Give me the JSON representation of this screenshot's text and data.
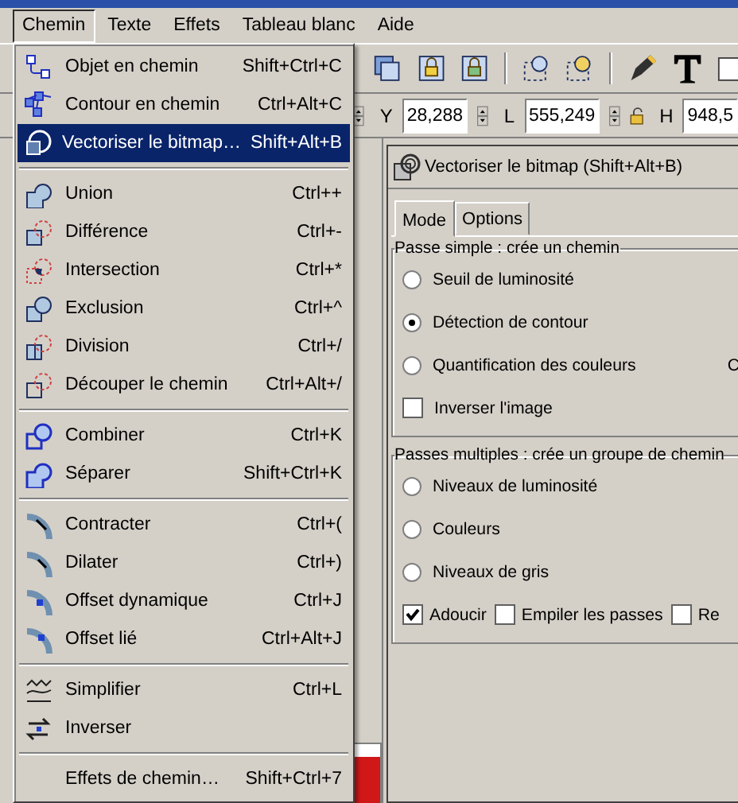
{
  "menubar": [
    {
      "label": "Chemin",
      "selected": true
    },
    {
      "label": "Texte",
      "selected": false
    },
    {
      "label": "Effets",
      "selected": false
    },
    {
      "label": "Tableau blanc",
      "selected": false
    },
    {
      "label": "Aide",
      "selected": false
    }
  ],
  "coords": [
    {
      "label": "Y",
      "value": "28,288"
    },
    {
      "label": "L",
      "value": "555,249"
    },
    {
      "label": "H",
      "value": "948,5"
    }
  ],
  "menu": {
    "sections": [
      {
        "items": [
          {
            "label": "Objet en chemin",
            "shortcut": "Shift+Ctrl+C",
            "selected": false
          },
          {
            "label": "Contour en chemin",
            "shortcut": "Ctrl+Alt+C",
            "selected": false
          },
          {
            "label": "Vectoriser le bitmap…",
            "shortcut": "Shift+Alt+B",
            "selected": true
          }
        ]
      },
      {
        "items": [
          {
            "label": "Union",
            "shortcut": "Ctrl++",
            "selected": false
          },
          {
            "label": "Différence",
            "shortcut": "Ctrl+-",
            "selected": false
          },
          {
            "label": "Intersection",
            "shortcut": "Ctrl+*",
            "selected": false
          },
          {
            "label": "Exclusion",
            "shortcut": "Ctrl+^",
            "selected": false
          },
          {
            "label": "Division",
            "shortcut": "Ctrl+/",
            "selected": false
          },
          {
            "label": "Découper le chemin",
            "shortcut": "Ctrl+Alt+/",
            "selected": false
          }
        ]
      },
      {
        "items": [
          {
            "label": "Combiner",
            "shortcut": "Ctrl+K",
            "selected": false
          },
          {
            "label": "Séparer",
            "shortcut": "Shift+Ctrl+K",
            "selected": false
          }
        ]
      },
      {
        "items": [
          {
            "label": "Contracter",
            "shortcut": "Ctrl+(",
            "selected": false
          },
          {
            "label": "Dilater",
            "shortcut": "Ctrl+)",
            "selected": false
          },
          {
            "label": "Offset dynamique",
            "shortcut": "Ctrl+J",
            "selected": false
          },
          {
            "label": "Offset lié",
            "shortcut": "Ctrl+Alt+J",
            "selected": false
          }
        ]
      },
      {
        "items": [
          {
            "label": "Simplifier",
            "shortcut": "Ctrl+L",
            "selected": false
          },
          {
            "label": "Inverser",
            "selected": false
          }
        ]
      },
      {
        "items": [
          {
            "label": "Effets de chemin…",
            "shortcut": "Shift+Ctrl+7",
            "selected": false
          }
        ]
      }
    ]
  },
  "dialog": {
    "title": "Vectoriser le bitmap (Shift+Alt+B)",
    "tabs": [
      {
        "label": "Mode",
        "selected": true
      },
      {
        "label": "Options",
        "selected": false
      }
    ],
    "groups": [
      {
        "title": "Passe simple : crée un chemin",
        "options": [
          {
            "kind": "radio",
            "label": "Seuil de luminosité",
            "checked": false
          },
          {
            "kind": "radio",
            "label": "Détection de contour",
            "checked": true
          },
          {
            "kind": "radio",
            "label": "Quantification des couleurs",
            "checked": false,
            "side_label": "C"
          },
          {
            "kind": "checkbox",
            "label": "Inverser l'image",
            "checked": false
          }
        ]
      },
      {
        "title": "Passes multiples : crée un groupe de chemin",
        "options": [
          {
            "kind": "radio",
            "label": "Niveaux de luminosité",
            "checked": false
          },
          {
            "kind": "radio",
            "label": "Couleurs",
            "checked": false
          },
          {
            "kind": "radio",
            "label": "Niveaux de gris",
            "checked": false
          },
          {
            "kind": "checkrow",
            "boxes": [
              {
                "label": "Adoucir",
                "checked": true
              },
              {
                "label": "Empiler les passes",
                "checked": false
              },
              {
                "label": "Re",
                "checked": false
              }
            ]
          }
        ]
      }
    ]
  }
}
